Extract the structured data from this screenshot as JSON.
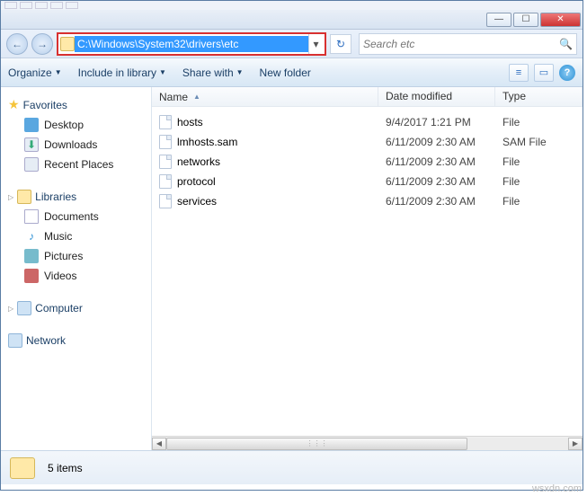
{
  "titlebar": {
    "min": "—",
    "max": "☐",
    "close": "✕"
  },
  "nav": {
    "back": "←",
    "forward": "→",
    "path": "C:\\Windows\\System32\\drivers\\etc",
    "dropdown": "▾",
    "refresh": "↻"
  },
  "search": {
    "placeholder": "Search etc",
    "icon": "🔍"
  },
  "toolbar": {
    "organize": "Organize",
    "include": "Include in library",
    "share": "Share with",
    "newfolder": "New folder",
    "view1": "≡",
    "view2": "▭",
    "help": "?"
  },
  "sidebar": {
    "favorites": {
      "label": "Favorites",
      "items": [
        {
          "label": "Desktop",
          "cls": "ico-desktop"
        },
        {
          "label": "Downloads",
          "cls": "ico-down"
        },
        {
          "label": "Recent Places",
          "cls": "ico-recent"
        }
      ]
    },
    "libraries": {
      "label": "Libraries",
      "items": [
        {
          "label": "Documents",
          "cls": "ico-doc"
        },
        {
          "label": "Music",
          "cls": "ico-music",
          "glyph": "♪"
        },
        {
          "label": "Pictures",
          "cls": "ico-pic"
        },
        {
          "label": "Videos",
          "cls": "ico-vid"
        }
      ]
    },
    "computer": {
      "label": "Computer"
    },
    "network": {
      "label": "Network"
    }
  },
  "columns": {
    "name": "Name",
    "date": "Date modified",
    "type": "Type"
  },
  "files": [
    {
      "name": "hosts",
      "date": "9/4/2017 1:21 PM",
      "type": "File"
    },
    {
      "name": "lmhosts.sam",
      "date": "6/11/2009 2:30 AM",
      "type": "SAM File"
    },
    {
      "name": "networks",
      "date": "6/11/2009 2:30 AM",
      "type": "File"
    },
    {
      "name": "protocol",
      "date": "6/11/2009 2:30 AM",
      "type": "File"
    },
    {
      "name": "services",
      "date": "6/11/2009 2:30 AM",
      "type": "File"
    }
  ],
  "status": {
    "count": "5 items"
  },
  "watermark": "wsxdn.com"
}
